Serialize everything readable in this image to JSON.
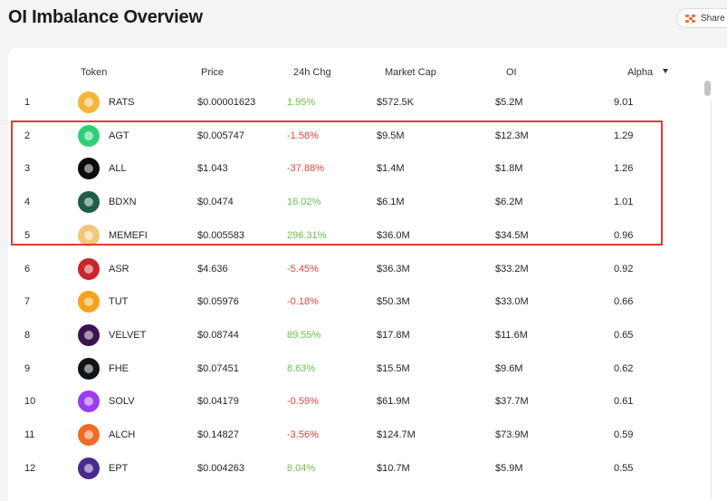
{
  "page": {
    "title": "OI Imbalance Overview"
  },
  "share": {
    "label": "Share",
    "icon": "share-icon"
  },
  "table": {
    "columns": {
      "token": "Token",
      "price": "Price",
      "change": "24h Chg",
      "market_cap": "Market Cap",
      "oi": "OI",
      "alpha": "Alpha"
    },
    "sort_icon": "caret-down-icon",
    "rows": [
      {
        "rank": "1",
        "token": "RATS",
        "price": "$0.00001623",
        "change": "1.95%",
        "change_dir": "pos",
        "market_cap": "$572.5K",
        "oi": "$5.2M",
        "alpha": "9.01",
        "logo_color": "#f4b63a"
      },
      {
        "rank": "2",
        "token": "AGT",
        "price": "$0.005747",
        "change": "-1.58%",
        "change_dir": "neg",
        "market_cap": "$9.5M",
        "oi": "$12.3M",
        "alpha": "1.29",
        "logo_color": "#2fcf7a"
      },
      {
        "rank": "3",
        "token": "ALL",
        "price": "$1.043",
        "change": "-37.88%",
        "change_dir": "neg",
        "market_cap": "$1.4M",
        "oi": "$1.8M",
        "alpha": "1.26",
        "logo_color": "#0b0b0b"
      },
      {
        "rank": "4",
        "token": "BDXN",
        "price": "$0.0474",
        "change": "16.02%",
        "change_dir": "pos",
        "market_cap": "$6.1M",
        "oi": "$6.2M",
        "alpha": "1.01",
        "logo_color": "#1f5c4a"
      },
      {
        "rank": "5",
        "token": "MEMEFI",
        "price": "$0.005583",
        "change": "296.31%",
        "change_dir": "pos",
        "market_cap": "$36.0M",
        "oi": "$34.5M",
        "alpha": "0.96",
        "logo_color": "#f3c77a"
      },
      {
        "rank": "6",
        "token": "ASR",
        "price": "$4.636",
        "change": "-5.45%",
        "change_dir": "neg",
        "market_cap": "$36.3M",
        "oi": "$33.2M",
        "alpha": "0.92",
        "logo_color": "#c8262c"
      },
      {
        "rank": "7",
        "token": "TUT",
        "price": "$0.05976",
        "change": "-0.18%",
        "change_dir": "neg",
        "market_cap": "$50.3M",
        "oi": "$33.0M",
        "alpha": "0.66",
        "logo_color": "#f7a21b"
      },
      {
        "rank": "8",
        "token": "VELVET",
        "price": "$0.08744",
        "change": "89.55%",
        "change_dir": "pos",
        "market_cap": "$17.8M",
        "oi": "$11.6M",
        "alpha": "0.65",
        "logo_color": "#3a1450"
      },
      {
        "rank": "9",
        "token": "FHE",
        "price": "$0.07451",
        "change": "8.63%",
        "change_dir": "pos",
        "market_cap": "$15.5M",
        "oi": "$9.6M",
        "alpha": "0.62",
        "logo_color": "#101418"
      },
      {
        "rank": "10",
        "token": "SOLV",
        "price": "$0.04179",
        "change": "-0.59%",
        "change_dir": "neg",
        "market_cap": "$61.9M",
        "oi": "$37.7M",
        "alpha": "0.61",
        "logo_color": "#9b3cf0"
      },
      {
        "rank": "11",
        "token": "ALCH",
        "price": "$0.14827",
        "change": "-3.56%",
        "change_dir": "neg",
        "market_cap": "$124.7M",
        "oi": "$73.9M",
        "alpha": "0.59",
        "logo_color": "#f26a24"
      },
      {
        "rank": "12",
        "token": "EPT",
        "price": "$0.004263",
        "change": "8.04%",
        "change_dir": "pos",
        "market_cap": "$10.7M",
        "oi": "$5.9M",
        "alpha": "0.55",
        "logo_color": "#4a2a8c"
      }
    ]
  },
  "highlight": {
    "rows": [
      "2",
      "3",
      "4",
      "5"
    ],
    "color": "#e03b34"
  }
}
